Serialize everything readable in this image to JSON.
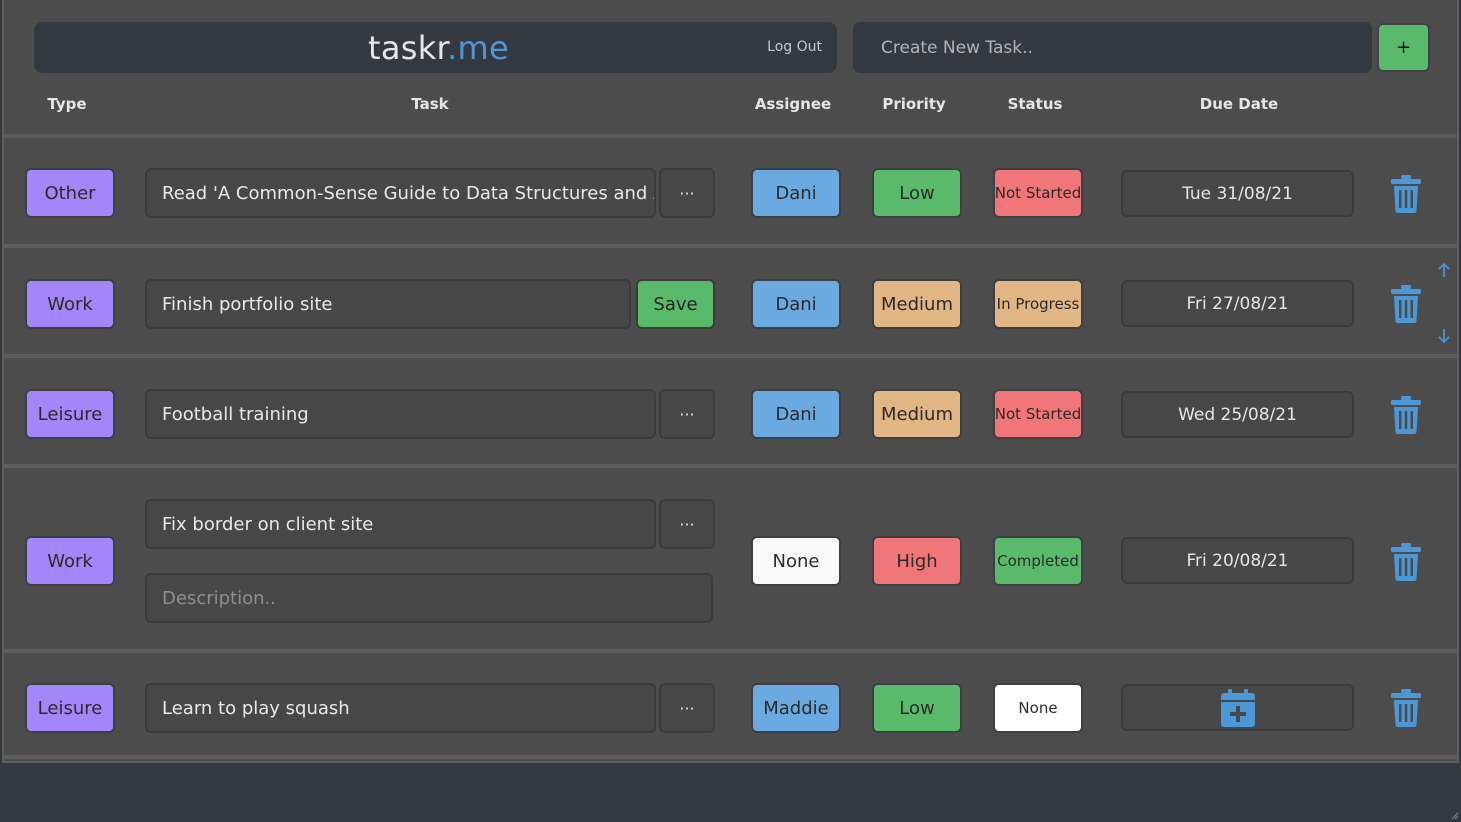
{
  "header": {
    "brand_main": "taskr",
    "brand_dot": ".me",
    "logout_label": "Log Out",
    "new_task_placeholder": "Create New Task..",
    "add_label": "+"
  },
  "columns": {
    "type": "Type",
    "task": "Task",
    "assignee": "Assignee",
    "priority": "Priority",
    "status": "Status",
    "due": "Due Date"
  },
  "more_label": "···",
  "rows": [
    {
      "type": "Other",
      "task": "Read 'A Common-Sense Guide to Data Structures and Alg",
      "assignee": "Dani",
      "priority": "Low",
      "status": "Not Started",
      "due": "Tue 31/08/21"
    },
    {
      "type": "Work",
      "task": "Finish portfolio site",
      "save_label": "Save",
      "assignee": "Dani",
      "priority": "Medium",
      "status": "In Progress",
      "due": "Fri 27/08/21"
    },
    {
      "type": "Leisure",
      "task": "Football training",
      "assignee": "Dani",
      "priority": "Medium",
      "status": "Not Started",
      "due": "Wed 25/08/21"
    },
    {
      "type": "Work",
      "task": "Fix border on client site",
      "description_placeholder": "Description..",
      "assignee": "None",
      "priority": "High",
      "status": "Completed",
      "due": "Fri 20/08/21"
    },
    {
      "type": "Leisure",
      "task": "Learn to play squash",
      "assignee": "Maddie",
      "priority": "Low",
      "status": "None",
      "due_icon": "calendar-plus-icon"
    }
  ],
  "colors": {
    "accent_blue": "#4c97d5",
    "type_purple": "#a586f8",
    "assignee_blue": "#6aaae0",
    "green": "#58ba6a",
    "orange": "#e2b785",
    "red": "#f17679"
  }
}
